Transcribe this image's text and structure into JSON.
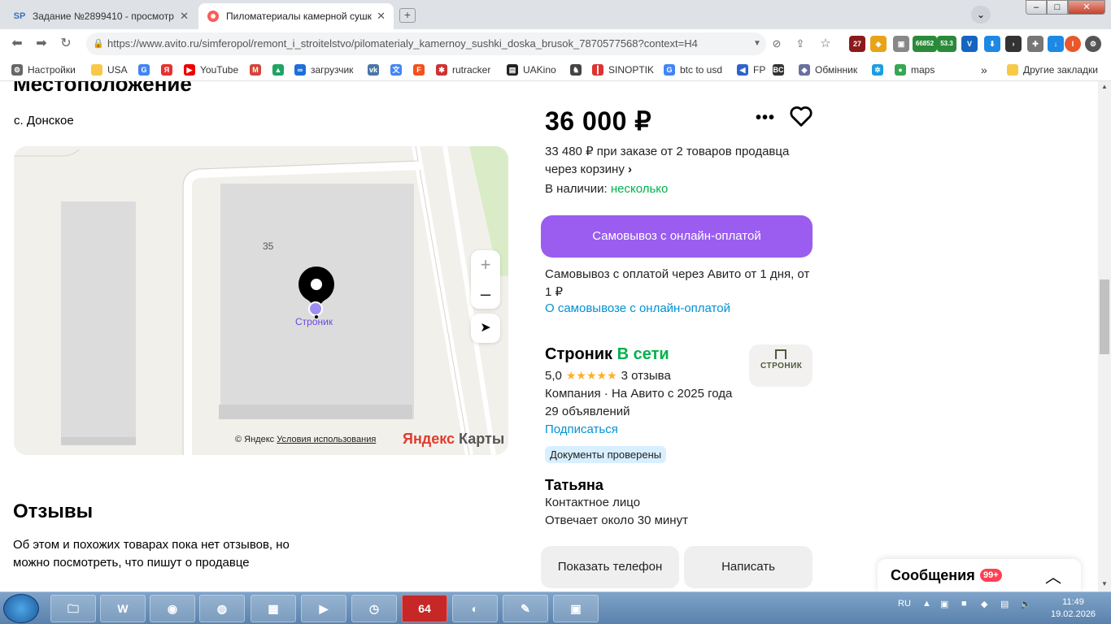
{
  "browser": {
    "tabs": [
      {
        "icon": "SP",
        "title": "Задание №2899410 - просмотр з",
        "active": false
      },
      {
        "icon": "avito-icon",
        "title": "Пиломатериалы камерной сушк",
        "active": true
      }
    ],
    "url": "https://www.avito.ru/simferopol/remont_i_stroitelstvo/pilomaterialy_kamernoy_sushki_doska_brusok_7870577568?context=H4",
    "ext_badges": {
      "counter1": "27",
      "btc": "66852",
      "ltc_label": "LTC",
      "ltc": "53.3"
    },
    "bookmarks": [
      {
        "label": "Настройки",
        "icon": "gear-icon"
      },
      {
        "label": "USA",
        "icon": "folder-icon"
      },
      {
        "label": "",
        "icon": "google-icon"
      },
      {
        "label": "",
        "icon": "yandex-icon"
      },
      {
        "label": "YouTube",
        "icon": "youtube-icon"
      },
      {
        "label": "",
        "icon": "gmail-icon"
      },
      {
        "label": "",
        "icon": "drive-icon"
      },
      {
        "label": "загрузчик",
        "icon": "infinity-icon"
      },
      {
        "label": "",
        "icon": "vk-icon"
      },
      {
        "label": "",
        "icon": "translate-icon"
      },
      {
        "label": "",
        "icon": "f-icon"
      },
      {
        "label": "rutracker",
        "icon": "rutracker-icon"
      },
      {
        "label": "UAKino",
        "icon": "uakino-icon"
      },
      {
        "label": "",
        "icon": "chess-icon"
      },
      {
        "label": "SINOPTIK",
        "icon": "thermometer-icon"
      },
      {
        "label": "btc to usd",
        "icon": "google-icon"
      },
      {
        "label": "FP",
        "icon": "fp-icon"
      },
      {
        "label": "",
        "icon": "bc-icon"
      },
      {
        "label": "Обмінник",
        "icon": "exchange-icon"
      },
      {
        "label": "",
        "icon": "kyivstar-icon"
      },
      {
        "label": "maps",
        "icon": "maps-icon"
      },
      {
        "label": "Другие закладки",
        "icon": "folder-icon"
      }
    ],
    "more_bookmarks": "»"
  },
  "page": {
    "location_heading": "Местоположение",
    "address": "с. Донское",
    "map": {
      "building_number": "35",
      "pin_label": "Строник",
      "copyright": "© Яндекс",
      "terms": "Условия использования",
      "brand_a": "Яндекс",
      "brand_b": " Карты"
    },
    "reviews_heading": "Отзывы",
    "reviews_text": "Об этом и похожих товарах пока нет отзывов, но можно посмотреть, что пишут о продавце",
    "price": "36 000 ₽",
    "discount": "33 480 ₽ при заказе от 2 товаров продавца через корзину",
    "discount_chevron": "›",
    "stock_label": "В наличии: ",
    "stock_value": "несколько",
    "buy_button": "Самовывоз с онлайн-оплатой",
    "pickup_text": "Самовывоз с оплатой через Авито от 1 дня, от 1 ₽",
    "pickup_link": "О самовывозе с онлайн-оплатой",
    "seller": {
      "name": "Строник",
      "status": "В сети",
      "logo_text": "СТРОНИК",
      "rating": "5,0",
      "stars": "★★★★★",
      "reviews": "3 отзыва",
      "company": "Компания · На Авито с 2025 года",
      "ads": "29 объявлений",
      "subscribe": "Подписаться",
      "docs_badge": "Документы проверены"
    },
    "contact": {
      "name": "Татьяна",
      "role": "Контактное лицо",
      "reply": "Отвечает около 30 минут"
    },
    "show_phone": "Показать телефон",
    "write": "Написать",
    "messages": {
      "title": "Сообщения",
      "badge": "99+"
    }
  },
  "taskbar": {
    "lang": "RU",
    "time": "11:49",
    "date": "19.02.2026",
    "app64": "64"
  },
  "colors": {
    "accent_purple": "#9a5df0",
    "link_blue": "#0091d6",
    "online_green": "#02b14b",
    "star_yellow": "#ffb021"
  }
}
